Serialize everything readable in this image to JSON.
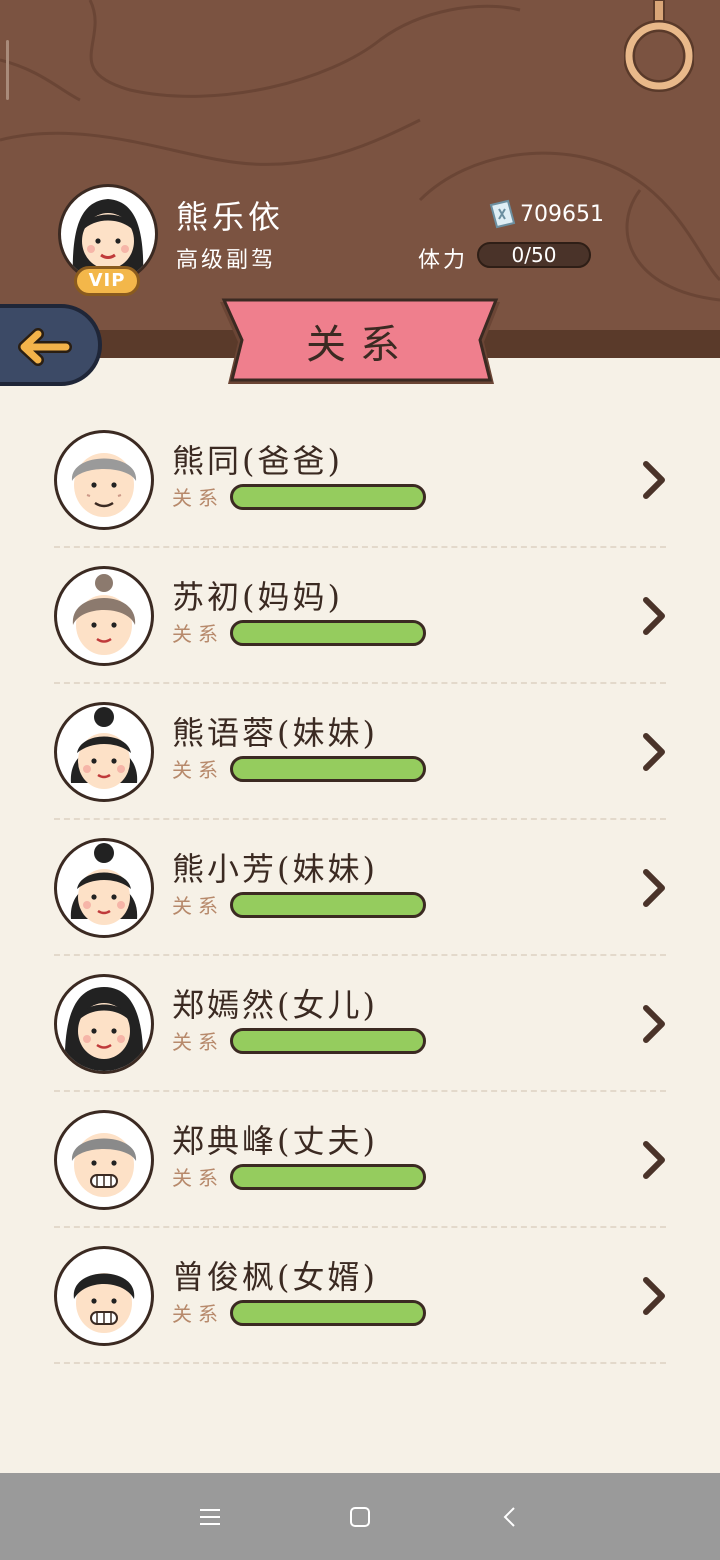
{
  "profile": {
    "name": "熊乐依",
    "rank": "高级副驾",
    "vip_label": "VIP",
    "money": "709651",
    "stamina_label": "体力",
    "stamina_value": "0/50"
  },
  "page_title": "关系",
  "relation_label": "关系",
  "relations": [
    {
      "name": "熊同(爸爸)",
      "level": 1.0
    },
    {
      "name": "苏初(妈妈)",
      "level": 1.0
    },
    {
      "name": "熊语蓉(妹妹)",
      "level": 1.0
    },
    {
      "name": "熊小芳(妹妹)",
      "level": 1.0
    },
    {
      "name": "郑嫣然(女儿)",
      "level": 1.0
    },
    {
      "name": "郑典峰(丈夫)",
      "level": 1.0
    },
    {
      "name": "曾俊枫(女婿)",
      "level": 1.0
    }
  ],
  "icons": {
    "back": "back-arrow-icon",
    "money": "banknote-icon",
    "chevron": "chevron-right-icon",
    "ring": "ring-icon",
    "nav": [
      "menu-icon",
      "home-square-icon",
      "back-chevron-icon"
    ]
  },
  "colors": {
    "header_wood": "#7b5341",
    "banner_pink": "#ef7f8d",
    "bar_green": "#95cc5e",
    "back_button": "#3c4a66"
  }
}
